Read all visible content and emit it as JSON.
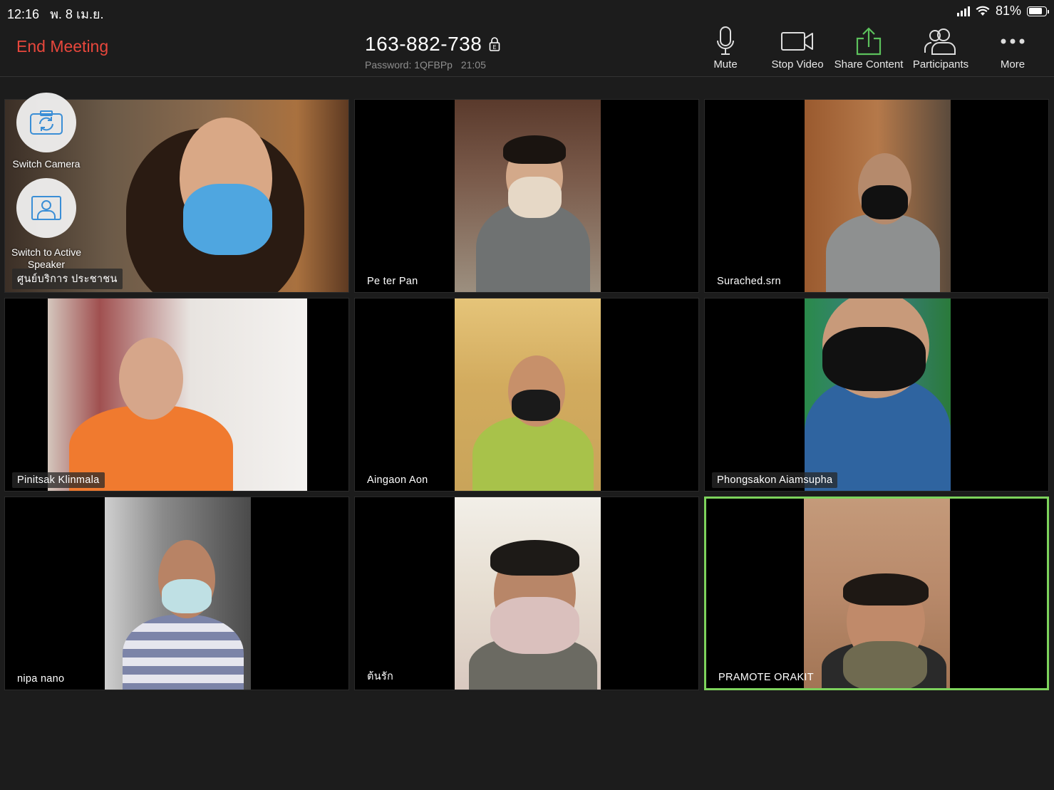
{
  "status_bar": {
    "time": "12:16",
    "date": "พ. 8 เม.ย.",
    "battery_percent": "81%",
    "battery_level": 0.81
  },
  "toolbar": {
    "end_meeting": "End Meeting",
    "meeting_id": "163-882-738",
    "password": "Password: 1QFBPp",
    "duration": "21:05",
    "mute": "Mute",
    "stop_video": "Stop Video",
    "share_content": "Share Content",
    "participants": "Participants",
    "more": "More"
  },
  "colors": {
    "end_meeting": "#e8473c",
    "share_icon": "#5cc15c",
    "active_border": "#7dd35c"
  },
  "overlay": {
    "switch_camera": "Switch Camera",
    "switch_to_active_speaker": "Switch to Active Speaker"
  },
  "participants": [
    {
      "name": "ศูนย์บริการ ประชาชน"
    },
    {
      "name": "Pe ter Pan"
    },
    {
      "name": "Surached.srn"
    },
    {
      "name": "Pinitsak Klinmala"
    },
    {
      "name": "Aingaon Aon"
    },
    {
      "name": "Phongsakon Aiamsupha"
    },
    {
      "name": "nipa nano"
    },
    {
      "name": "ต้นรัก"
    },
    {
      "name": "PRAMOTE ORAKIT",
      "active_speaker": true
    }
  ]
}
